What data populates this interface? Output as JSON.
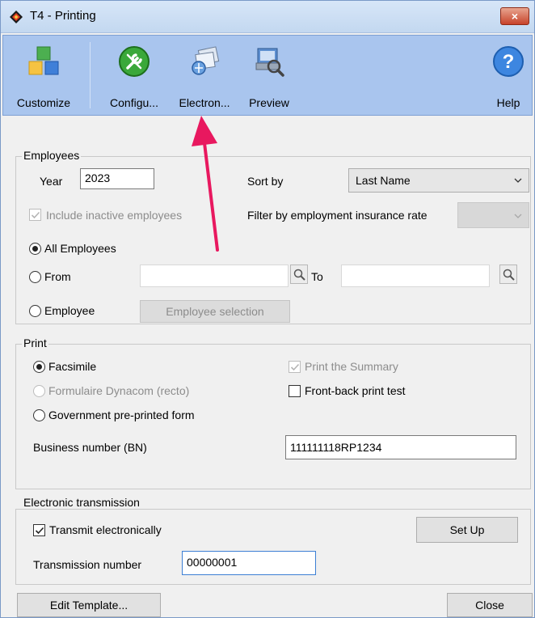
{
  "window": {
    "title": "T4 - Printing",
    "close_label": "×"
  },
  "toolbar": {
    "buttons": [
      {
        "label": "Customize",
        "icon": "cubes-icon"
      },
      {
        "label": "Configu...",
        "icon": "wrench-icon"
      },
      {
        "label": "Electron...",
        "icon": "electronic-transmission-icon"
      },
      {
        "label": "Preview",
        "icon": "preview-icon"
      },
      {
        "label": "Help",
        "icon": "help-icon"
      }
    ]
  },
  "employees": {
    "group_title": "Employees",
    "year_label": "Year",
    "year_value": "2023",
    "sort_by_label": "Sort by",
    "sort_by_value": "Last Name",
    "include_inactive_label": "Include inactive employees",
    "filter_label": "Filter by employment insurance rate",
    "filter_value": "",
    "all_employees_label": "All Employees",
    "from_label": "From",
    "from_value": "",
    "to_label": "To",
    "to_value": "",
    "employee_label": "Employee",
    "employee_selection_button": "Employee selection"
  },
  "print": {
    "group_title": "Print",
    "facsimile_label": "Facsimile",
    "dynacom_label": "Formulaire Dynacom (recto)",
    "government_label": "Government pre-printed form",
    "print_summary_label": "Print the Summary",
    "front_back_label": "Front-back print test",
    "bn_label": "Business number (BN)",
    "bn_value": "111111118RP1234"
  },
  "electronic": {
    "group_title": "Electronic transmission",
    "transmit_label": "Transmit electronically",
    "setup_button": "Set Up",
    "transmission_number_label": "Transmission number",
    "transmission_number_value": "00000001"
  },
  "footer": {
    "edit_template_button": "Edit Template...",
    "close_button": "Close"
  },
  "colors": {
    "toolbar_bg": "#a9c5ee",
    "annotation_arrow": "#e8185f"
  }
}
